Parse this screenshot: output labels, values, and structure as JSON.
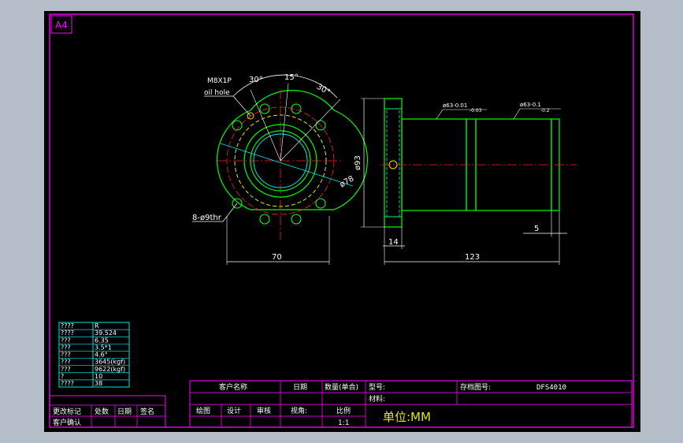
{
  "sheet": {
    "size_label": "A4",
    "colors": {
      "background": "#000000",
      "frame": "#ff00ff",
      "dimension": "#ffffff",
      "outline": "#00ff00",
      "hidden": "#e8e800",
      "centerline": "#ff2020",
      "table": "#00e5e5",
      "outer_bg": "#b5bdc9"
    }
  },
  "drawing": {
    "oil_hole_note_line1": "M8X1P",
    "oil_hole_note_line2": "oil hole",
    "angle_left": "30°",
    "angle_mid": "15°",
    "angle_right": "30°",
    "bolt_holes": "8-ø9thr",
    "pcd": "ø78",
    "flange_width": "70",
    "flange_dia": "ø93",
    "tol1": "ø63-0.01",
    "tol1b": "-0.03",
    "tol2": "ø63-0.1",
    "tol2b": "-0.2",
    "flange_thickness": "14",
    "total_length": "123",
    "end_step": "5"
  },
  "spec_table": {
    "rows": [
      {
        "label": "????",
        "value": "R"
      },
      {
        "label": "????",
        "value": "39.524"
      },
      {
        "label": "???",
        "value": "6.35"
      },
      {
        "label": "???",
        "value": "3.5*1"
      },
      {
        "label": "???",
        "value": "4.6°"
      },
      {
        "label": "???",
        "value": "3645(kgf)"
      },
      {
        "label": "???",
        "value": "9622(kgf)"
      },
      {
        "label": "?",
        "value": "10"
      },
      {
        "label": "????",
        "value": "38"
      }
    ]
  },
  "revision_block": {
    "h1": "更改标记",
    "h2": "处数",
    "h3": "日期",
    "h4": "签名",
    "row2": "客户确认"
  },
  "title_block": {
    "customer_name": "客户名称",
    "date": "日期",
    "quantity": "数量(单合)",
    "model": "型号:",
    "drawing_no_label": "存档图号:",
    "drawing_no": "DFS4010",
    "material": "材料:",
    "drawn": "绘图",
    "design": "设计",
    "review": "审核",
    "view": "视角:",
    "scale_label": "比例",
    "scale": "1:1",
    "unit": "单位:MM"
  }
}
